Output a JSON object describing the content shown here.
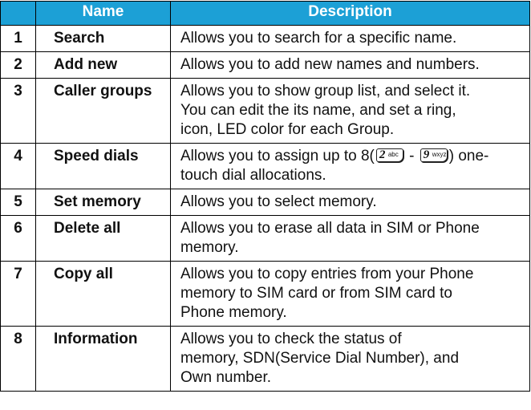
{
  "table": {
    "headers": {
      "name": "Name",
      "description": "Description"
    },
    "rows": [
      {
        "num": "1",
        "name": "Search",
        "desc_lines": [
          "Allows you to search for a specific name."
        ]
      },
      {
        "num": "2",
        "name": "Add new",
        "desc_lines": [
          "Allows you to add new names and numbers."
        ]
      },
      {
        "num": "3",
        "name": "Caller groups",
        "desc_lines": [
          "Allows you to show group list, and select it.",
          "You can edit the its name, and set a ring,",
          "icon, LED color for each Group."
        ]
      },
      {
        "num": "4",
        "name": "Speed dials",
        "desc_lines": [
          "Allows you to assign up to 8(",
          "-",
          ") one-",
          "touch dial allocations."
        ]
      },
      {
        "num": "5",
        "name": "Set memory",
        "desc_lines": [
          "Allows you to select memory."
        ]
      },
      {
        "num": "6",
        "name": "Delete all",
        "desc_lines": [
          "Allows you to erase all data in SIM or Phone",
          "memory."
        ]
      },
      {
        "num": "7",
        "name": "Copy all",
        "desc_lines": [
          "Allows you to copy entries from your Phone",
          "memory to SIM card or from SIM card to",
          "Phone memory."
        ]
      },
      {
        "num": "8",
        "name": "Information",
        "desc_lines": [
          "Allows you to check the status of",
          "memory, SDN(Service Dial Number), and",
          "Own number."
        ]
      }
    ],
    "keys": {
      "first": {
        "digit": "2",
        "letters": "abc",
        "icon": "key-2-abc-icon"
      },
      "last": {
        "digit": "9",
        "letters": "wxyz",
        "icon": "key-9-wxyz-icon"
      }
    }
  },
  "colors": {
    "header_bg": "#1ca0d6",
    "header_text": "#ffffff",
    "border": "#000000"
  }
}
